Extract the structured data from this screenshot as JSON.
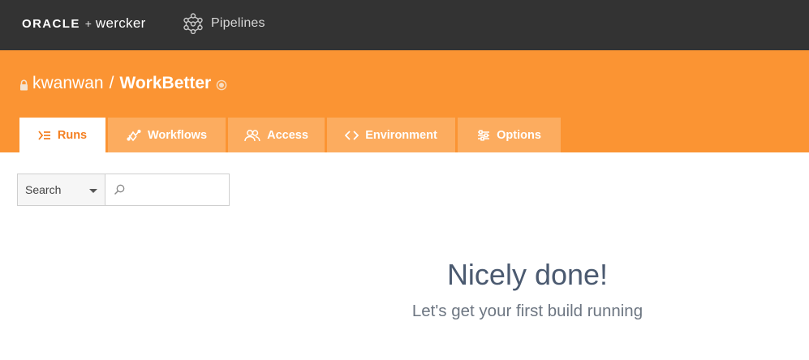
{
  "topbar": {
    "brand_oracle": "ORACLE",
    "brand_plus": "+",
    "brand_wercker": "wercker",
    "nav_pipelines": "Pipelines",
    "background": "#333333"
  },
  "header": {
    "owner": "kwanwan",
    "separator": "/",
    "app_name": "WorkBetter",
    "background": "#fb9433",
    "tabs": [
      {
        "label": "Runs",
        "icon": "runs-icon",
        "active": true
      },
      {
        "label": "Workflows",
        "icon": "workflows-icon",
        "active": false
      },
      {
        "label": "Access",
        "icon": "access-icon",
        "active": false
      },
      {
        "label": "Environment",
        "icon": "code-brackets-icon",
        "active": false
      },
      {
        "label": "Options",
        "icon": "sliders-icon",
        "active": false
      }
    ]
  },
  "search": {
    "filter_value": "Search",
    "placeholder": ""
  },
  "empty_state": {
    "title": "Nicely done!",
    "subtitle": "Let's get your first build running"
  }
}
